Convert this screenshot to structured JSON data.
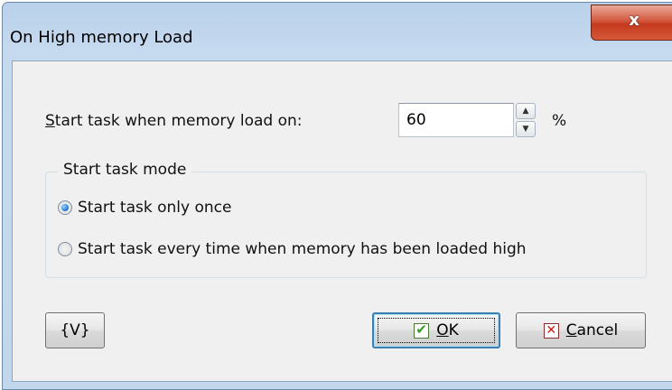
{
  "window": {
    "title": "On High memory Load",
    "close_label": "x"
  },
  "memory_load": {
    "label_accel": "S",
    "label_rest": "tart task when memory load on:",
    "value": "60",
    "unit": "%"
  },
  "mode_group": {
    "title": "Start task mode",
    "options": [
      {
        "label": "Start task only once",
        "checked": true
      },
      {
        "label": "Start task every time when memory has been loaded high",
        "checked": false
      }
    ]
  },
  "buttons": {
    "variables_label": "{V}",
    "ok_accel": "O",
    "ok_rest": "K",
    "cancel_accel": "C",
    "cancel_rest": "ancel"
  },
  "icons": {
    "close": "close-icon",
    "ok": "checkmark-icon",
    "cancel": "cross-icon",
    "spin_up": "arrow-up-icon",
    "spin_down": "arrow-down-icon"
  }
}
